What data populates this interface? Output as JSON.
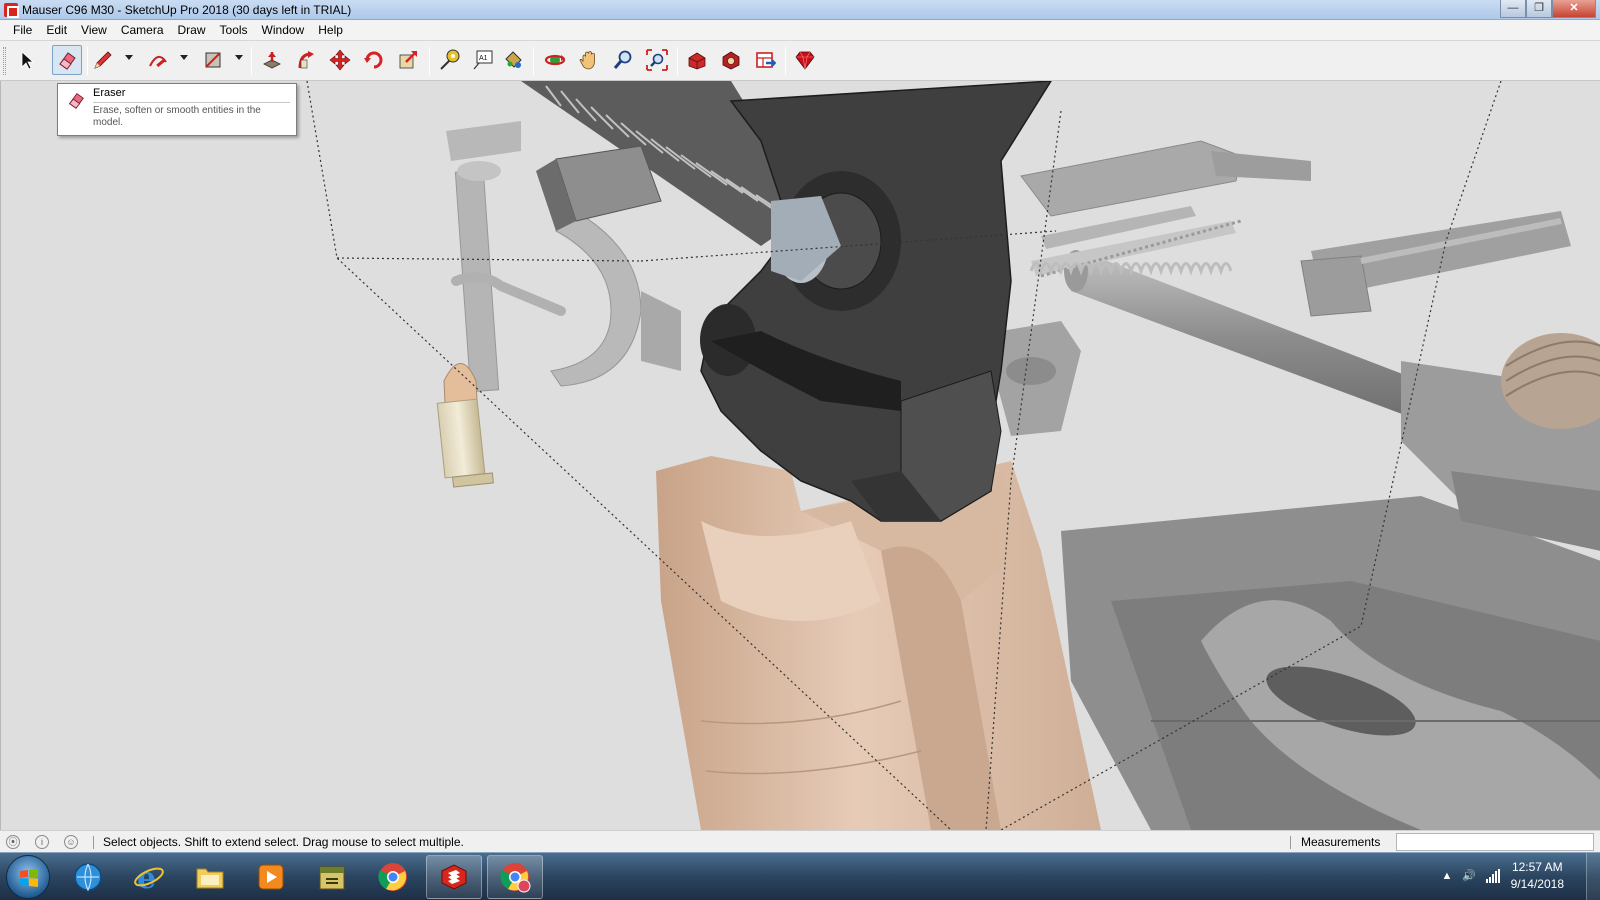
{
  "window": {
    "title": "Mauser C96 M30 - SketchUp Pro 2018 (30 days left in TRIAL)",
    "minimize_glyph": "—",
    "restore_glyph": "❐",
    "close_glyph": "✕"
  },
  "menu": {
    "items": [
      {
        "label": "File"
      },
      {
        "label": "Edit"
      },
      {
        "label": "View"
      },
      {
        "label": "Camera"
      },
      {
        "label": "Draw"
      },
      {
        "label": "Tools"
      },
      {
        "label": "Window"
      },
      {
        "label": "Help"
      }
    ]
  },
  "toolbar": {
    "tools": [
      {
        "name": "select-icon",
        "active": false
      },
      {
        "name": "eraser-icon",
        "active": true
      },
      {
        "name": "pencil-line-icon",
        "active": false
      },
      {
        "name": "arc-icon",
        "active": false
      },
      {
        "name": "rectangle-icon",
        "active": false
      },
      {
        "name": "push-pull-icon",
        "active": false
      },
      {
        "name": "offset-icon",
        "active": false
      },
      {
        "name": "move-icon",
        "active": false
      },
      {
        "name": "rotate-icon",
        "active": false
      },
      {
        "name": "scale-icon",
        "active": false
      },
      {
        "name": "tape-measure-icon",
        "active": false
      },
      {
        "name": "text-icon",
        "active": false
      },
      {
        "name": "paint-bucket-icon",
        "active": false
      },
      {
        "name": "orbit-icon",
        "active": false
      },
      {
        "name": "pan-icon",
        "active": false
      },
      {
        "name": "zoom-icon",
        "active": false
      },
      {
        "name": "zoom-extents-icon",
        "active": false
      },
      {
        "name": "3d-warehouse-icon",
        "active": false
      },
      {
        "name": "extension-warehouse-icon",
        "active": false
      },
      {
        "name": "layout-icon",
        "active": false
      },
      {
        "name": "ruby-console-icon",
        "active": false
      }
    ]
  },
  "tooltip": {
    "title": "Eraser",
    "description": "Erase, soften or smooth entities in the model."
  },
  "status": {
    "message": "Select objects. Shift to extend select. Drag mouse to select multiple.",
    "measurements_label": "Measurements",
    "measurements_value": "",
    "icon_geo": "⦿",
    "icon_info": "i",
    "icon_user": "☺"
  },
  "taskbar": {
    "apps": [
      {
        "name": "browser-globe-icon",
        "open": false
      },
      {
        "name": "internet-explorer-icon",
        "open": false
      },
      {
        "name": "file-explorer-icon",
        "open": false
      },
      {
        "name": "media-player-icon",
        "open": false
      },
      {
        "name": "archive-tool-icon",
        "open": false
      },
      {
        "name": "chrome-icon",
        "open": false
      },
      {
        "name": "sketchup-icon",
        "open": true
      },
      {
        "name": "chrome-profile-icon",
        "open": true
      }
    ],
    "clock_time": "12:57 AM",
    "clock_date": "9/14/2018",
    "tray_arrow": "▲",
    "tray_volume": "🔊",
    "tray_network": "▮"
  },
  "colors": {
    "viewport_bg": "#dedede",
    "model_dark": "#3f3f3f",
    "model_skin": "#e2c2ab",
    "model_gray": "#9b9b9b",
    "tooltip_bg": "#ffffff"
  }
}
